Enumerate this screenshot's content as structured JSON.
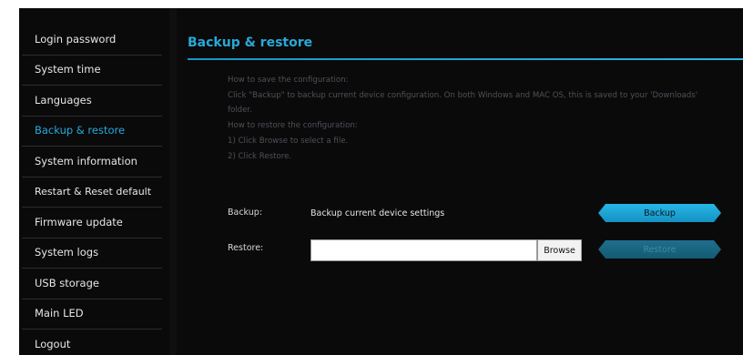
{
  "sidebar": {
    "items": [
      {
        "label": "Login password"
      },
      {
        "label": "System time"
      },
      {
        "label": "Languages"
      },
      {
        "label": "Backup & restore"
      },
      {
        "label": "System information"
      },
      {
        "label": "Restart & Reset default"
      },
      {
        "label": "Firmware update"
      },
      {
        "label": "System logs"
      },
      {
        "label": "USB storage"
      },
      {
        "label": "Main LED"
      },
      {
        "label": "Logout"
      }
    ],
    "active_index": 3
  },
  "main": {
    "title": "Backup & restore",
    "help": [
      "How to save the configuration:",
      "Click \"Backup\" to backup current device configuration. On both Windows and MAC OS, this is saved to your 'Downloads' folder.",
      "How to restore the configuration:",
      "1) Click Browse to select a file.",
      "2) Click Restore."
    ],
    "backup": {
      "label": "Backup:",
      "description": "Backup current device settings",
      "button": "Backup"
    },
    "restore": {
      "label": "Restore:",
      "file_value": "",
      "browse_button": "Browse",
      "button": "Restore"
    }
  },
  "colors": {
    "accent": "#28a9d8",
    "background": "#0a0a0b",
    "help_text": "#4e5157"
  }
}
